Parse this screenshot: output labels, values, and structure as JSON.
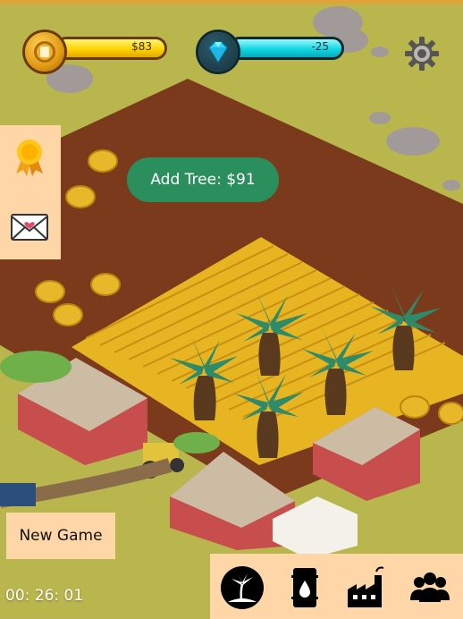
{
  "hud": {
    "gold_value": "$83",
    "gems_value": "-25"
  },
  "actions": {
    "add_tree_label": "Add Tree: $91",
    "new_game_label": "New Game"
  },
  "timer": {
    "value": "00: 26: 01"
  },
  "icons": {
    "coin": "coin-icon",
    "gem": "diamond-icon",
    "settings": "gear-icon",
    "achievements": "award-ribbon-icon",
    "messages": "envelope-heart-icon",
    "palm": "palm-island-icon",
    "oil": "oil-barrel-icon",
    "factory": "factory-icon",
    "people": "people-group-icon"
  },
  "colors": {
    "add_tree_bg": "#2a8f5c",
    "panel_bg": "#ffd6a8",
    "gold": "#ffd400",
    "gem": "#10d7e4"
  }
}
